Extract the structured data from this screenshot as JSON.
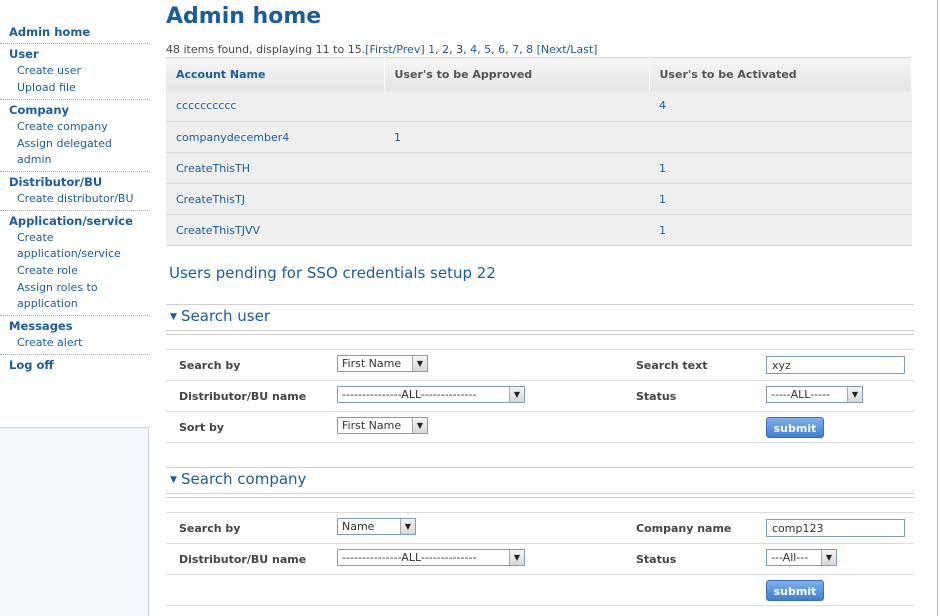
{
  "sidebar": {
    "sections": [
      {
        "heading": "Admin home",
        "items": []
      },
      {
        "heading": "User",
        "items": [
          "Create user",
          "Upload file"
        ]
      },
      {
        "heading": "Company",
        "items": [
          "Create company",
          "Assign delegated",
          "admin"
        ]
      },
      {
        "heading": "Distributor/BU",
        "items": [
          "Create distributor/BU"
        ]
      },
      {
        "heading": "Application/service",
        "items": [
          "Create",
          "application/service",
          "Create role",
          "Assign roles to",
          "application"
        ]
      },
      {
        "heading": "Messages",
        "items": [
          "Create alert"
        ]
      },
      {
        "heading": "Log off",
        "items": []
      }
    ]
  },
  "page_title": "Admin home",
  "pager": {
    "summary": "48 items found, displaying 11 to 15.",
    "first_prev": "[First/Prev]",
    "pages": [
      "1",
      "2",
      "3",
      "4",
      "5",
      "6",
      "7",
      "8"
    ],
    "current": "3",
    "next_last": "[Next/Last]"
  },
  "accounts_table": {
    "headers": [
      "Account Name",
      "User's to be Approved",
      "User's to be Activated"
    ],
    "rows": [
      [
        "cccccccccc",
        "",
        "4"
      ],
      [
        "companydecember4",
        "1",
        ""
      ],
      [
        "CreateThisTH",
        "",
        "1"
      ],
      [
        "CreateThisTJ",
        "",
        "1"
      ],
      [
        "CreateThisTJVV",
        "",
        "1"
      ]
    ]
  },
  "sso_heading": "Users pending for SSO credentials setup 22",
  "search_user": {
    "title": "Search user",
    "search_by_label": "Search by",
    "search_by_value": "First Name",
    "search_text_label": "Search text",
    "search_text_value": "xyz",
    "distributor_label": "Distributor/BU name",
    "distributor_value": "---------------ALL--------------",
    "status_label": "Status",
    "status_value": "-----ALL-----",
    "sort_by_label": "Sort by",
    "sort_by_value": "First Name",
    "submit_label": "submit"
  },
  "search_company": {
    "title": "Search company",
    "search_by_label": "Search by",
    "search_by_value": "Name",
    "company_name_label": "Company name",
    "company_name_value": "comp123",
    "distributor_label": "Distributor/BU name",
    "distributor_value": "---------------ALL--------------",
    "status_label": "Status",
    "status_value": "---All---",
    "submit_label": "submit"
  }
}
